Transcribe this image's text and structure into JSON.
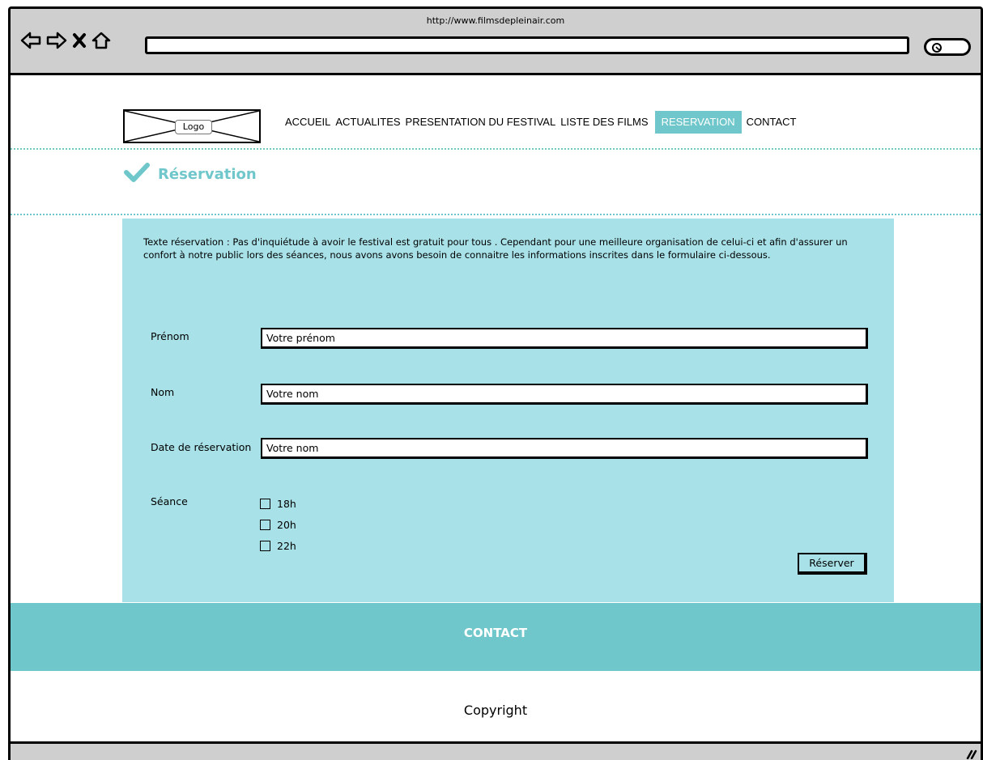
{
  "browser": {
    "url": "http://www.filmsdepleinair.com"
  },
  "header": {
    "logo_label": "Logo",
    "menu": [
      {
        "label": "ACCUEIL",
        "active": false
      },
      {
        "label": "ACTUALITES",
        "active": false
      },
      {
        "label": "PRESENTATION DU FESTIVAL",
        "active": false
      },
      {
        "label": "LISTE DES FILMS",
        "active": false
      },
      {
        "label": "RESERVATION",
        "active": true
      },
      {
        "label": "CONTACT",
        "active": false
      }
    ]
  },
  "title": {
    "icon": "check-icon",
    "text": "Réservation"
  },
  "form": {
    "intro": "Texte réservation : Pas d'inquiétude à avoir le festival est gratuit pour tous . Cependant pour une meilleure organisation de celui-ci et afin d'assurer un confort à notre public lors des séances, nous avons avons besoin de connaitre les informations inscrites dans le formulaire ci-dessous.",
    "fields": [
      {
        "label": "Prénom",
        "value": "Votre prénom"
      },
      {
        "label": "Nom",
        "value": "Votre nom"
      },
      {
        "label": "Date de réservation",
        "value": "Votre nom"
      }
    ],
    "seance_label": "Séance",
    "seances": [
      "18h",
      "20h",
      "22h"
    ],
    "submit_label": "Réserver"
  },
  "footer": {
    "contact": "CONTACT",
    "copyright": "Copyright"
  },
  "colors": {
    "accent": "#6fc7cb",
    "panel": "#a8e2e8",
    "chrome": "#cfcfcf"
  }
}
